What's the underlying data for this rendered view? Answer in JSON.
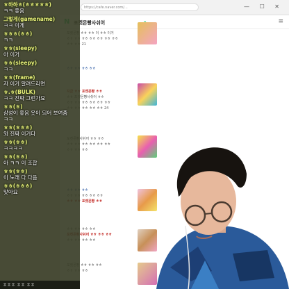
{
  "chat": {
    "messages": [
      {
        "nick": "ㅎ하하ㅎ(ㅎㅎㅎㅎㅎ)",
        "text": "ㅋㅋ 좋음"
      },
      {
        "nick": "그렇게(gamename)",
        "text": "ㅋㅋ 이게"
      },
      {
        "nick": "ㅎㅎㅎ(ㅎㅎ)",
        "text": "ㅋㅋ"
      },
      {
        "nick": "ㅎㅎ(sleepy)",
        "text": "아 이거"
      },
      {
        "nick": "ㅎㅎ(sleepy)",
        "text": "ㅋㅋ"
      },
      {
        "nick": "ㅎㅎ(frame)",
        "text": "자 이거 알려드리면"
      },
      {
        "nick": "ㅎ.ㅎ(BULK)",
        "text": "ㅋㅋ 진짜 그런가요"
      },
      {
        "nick": "ㅎㅎ(ㅎ)",
        "text": "삼성이 좋음 옷이 되어 보여줌",
        "text2": "ㅋㅋ"
      },
      {
        "nick": "ㅎㅎ(ㅎㅎㅎ)",
        "text": "와 진짜 이거다"
      },
      {
        "nick": "ㅎㅎ(ㅎㅎ)",
        "text": "ㅋㅋㅋㅋ"
      },
      {
        "nick": "ㅎㅎ(ㅎㅎ)",
        "text": "아 ㅋㅋ 이 조합"
      },
      {
        "nick": "ㅎㅎ(ㅎㅎ)",
        "text": "이 노래 다 다음"
      },
      {
        "nick": "ㅎㅎ(ㅎㅎㅎ)",
        "text": "맞아요"
      }
    ],
    "bottom": "ㅎㅎㅎ   ㅎㅎ ㅎㅎ"
  },
  "browser": {
    "url": "https://cafe.naver.com/...",
    "window_controls": "—  ☐  ✕"
  },
  "header": {
    "logo": "N",
    "cafe_name": "포켓몬빵사쉬어",
    "search_icon": "⌕",
    "menu_icon": "≡"
  },
  "posts": [
    {
      "lines": [
        "포켓몬빵 ㅎㅎ ㅎㅎ 이 ㅎㅎ 이거",
        "ㅎㅎ ㅎㅎ ㅎㅎ ㅎㅎ ㅎㅎ ㅎㅎ ㅎㅎ",
        "ㅎㅎ ㅎㅎ 21"
      ],
      "style": [
        "normal",
        "normal",
        "normal"
      ]
    },
    {
      "lines": [
        "ㅎㅎ ㅎㅎ ㅎㅎ ㅎㅎ"
      ],
      "style": [
        "blue"
      ]
    },
    {
      "lines": [
        "지금 ㅎㅎ 포켓몬빵 ㅎㅎ",
        "ㅎㅎ 포켓몬빵사쉬어 ㅎㅎ",
        "ㅎㅎ ㅎㅎ ㅎㅎ ㅎㅎ ㅎㅎ ㅎㅎ",
        "ㅎㅎ ㅎㅎ ㅎㅎ ㅎㅎ ㅎㅎ 24"
      ],
      "style": [
        "strong",
        "normal",
        "normal",
        "normal"
      ]
    },
    {
      "lines": [
        "포켓몬빵사쉬어 ㅎㅎ ㅎㅎ",
        "ㅎㅎ ㅎㅎ ㅎㅎ ㅎㅎ ㅎㅎ ㅎㅎ",
        "ㅎㅎ ㅎㅎ ㅎㅎ"
      ],
      "style": [
        "normal",
        "normal",
        "normal"
      ]
    },
    {
      "lines": [
        "ㅎㅎ ㅎㅎ ㅎㅎ",
        "ㅎㅎ ㅎㅎ ㅎㅎ ㅎㅎ ㅎㅎ",
        "ㅎㅎ ㅎㅎ 포켓몬빵 ㅎㅎ"
      ],
      "style": [
        "blue",
        "normal",
        "strong"
      ]
    },
    {
      "lines": [
        "ㅎㅎ ㅎㅎ ㅎㅎ ㅎㅎ",
        "포켓몬빵사쉬어 ㅎㅎ ㅎㅎ ㅎㅎ",
        "ㅎㅎ ㅎㅎ ㅎㅎ ㅎㅎ"
      ],
      "style": [
        "normal",
        "strong",
        "normal"
      ]
    },
    {
      "lines": [
        "포켓몬빵 ㅎㅎ ㅎㅎ ㅎㅎ",
        "ㅎㅎ ㅎㅎ ㅎㅎ"
      ],
      "style": [
        "normal",
        "normal"
      ]
    }
  ]
}
